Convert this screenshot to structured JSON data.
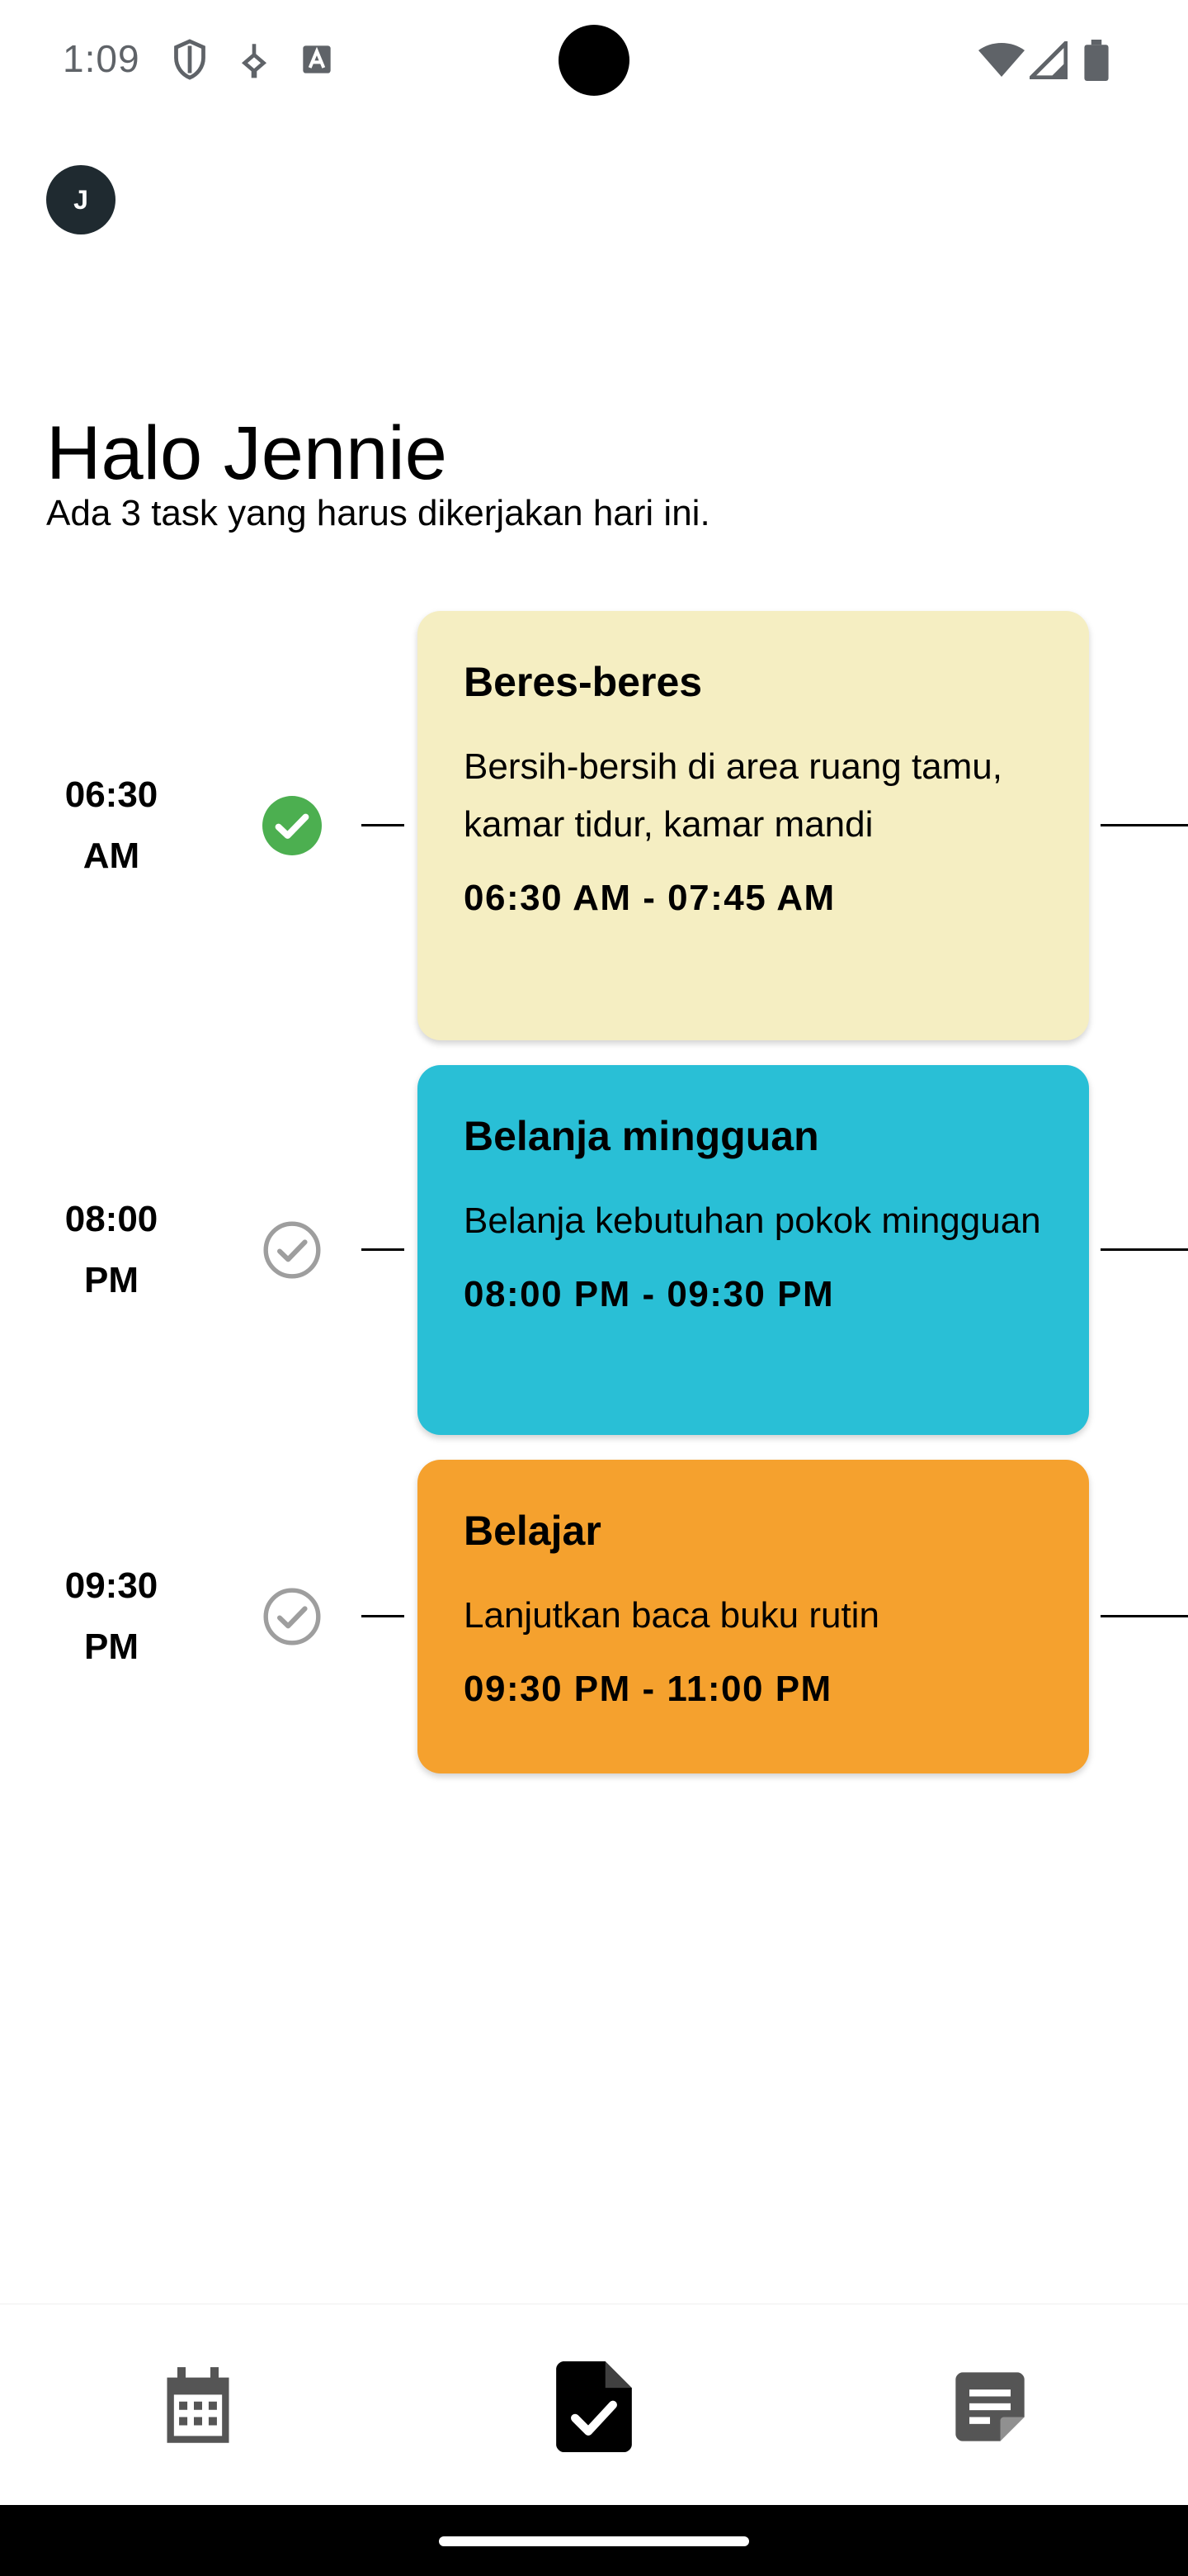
{
  "status_bar": {
    "time": "1:09",
    "left_icons": [
      "shield-icon",
      "usb-debug-icon",
      "font-a-icon"
    ],
    "right_icons": [
      "wifi-icon",
      "cell-signal-icon",
      "battery-icon"
    ]
  },
  "user": {
    "avatar_initial": "J"
  },
  "greeting": {
    "title": "Halo Jennie",
    "subtitle": "Ada 3 task yang harus dikerjakan hari ini."
  },
  "tasks": [
    {
      "time_line1": "06:30",
      "time_line2": "AM",
      "title": "Beres-beres",
      "description": "Bersih-bersih di area ruang tamu, kamar tidur, kamar mandi",
      "range": "06:30 AM - 07:45 AM",
      "done": true,
      "color": "#F5EEC2"
    },
    {
      "time_line1": "08:00",
      "time_line2": "PM",
      "title": "Belanja mingguan",
      "description": "Belanja kebutuhan pokok mingguan",
      "range": "08:00 PM - 09:30 PM",
      "done": false,
      "color": "#29BFD6"
    },
    {
      "time_line1": "09:30",
      "time_line2": "PM",
      "title": "Belajar",
      "description": "Lanjutkan baca buku rutin",
      "range": "09:30 PM - 11:00 PM",
      "done": false,
      "color": "#F5A12E"
    }
  ],
  "bottom_nav": {
    "items": [
      {
        "icon": "calendar-icon",
        "active": false
      },
      {
        "icon": "task-file-check-icon",
        "active": true
      },
      {
        "icon": "notes-icon",
        "active": false
      }
    ]
  },
  "colors": {
    "done_check": "#4CAF50",
    "pending_check": "#9E9E9E",
    "nav_inactive": "#555555",
    "nav_active": "#000000",
    "avatar_bg": "#1F2A30"
  }
}
